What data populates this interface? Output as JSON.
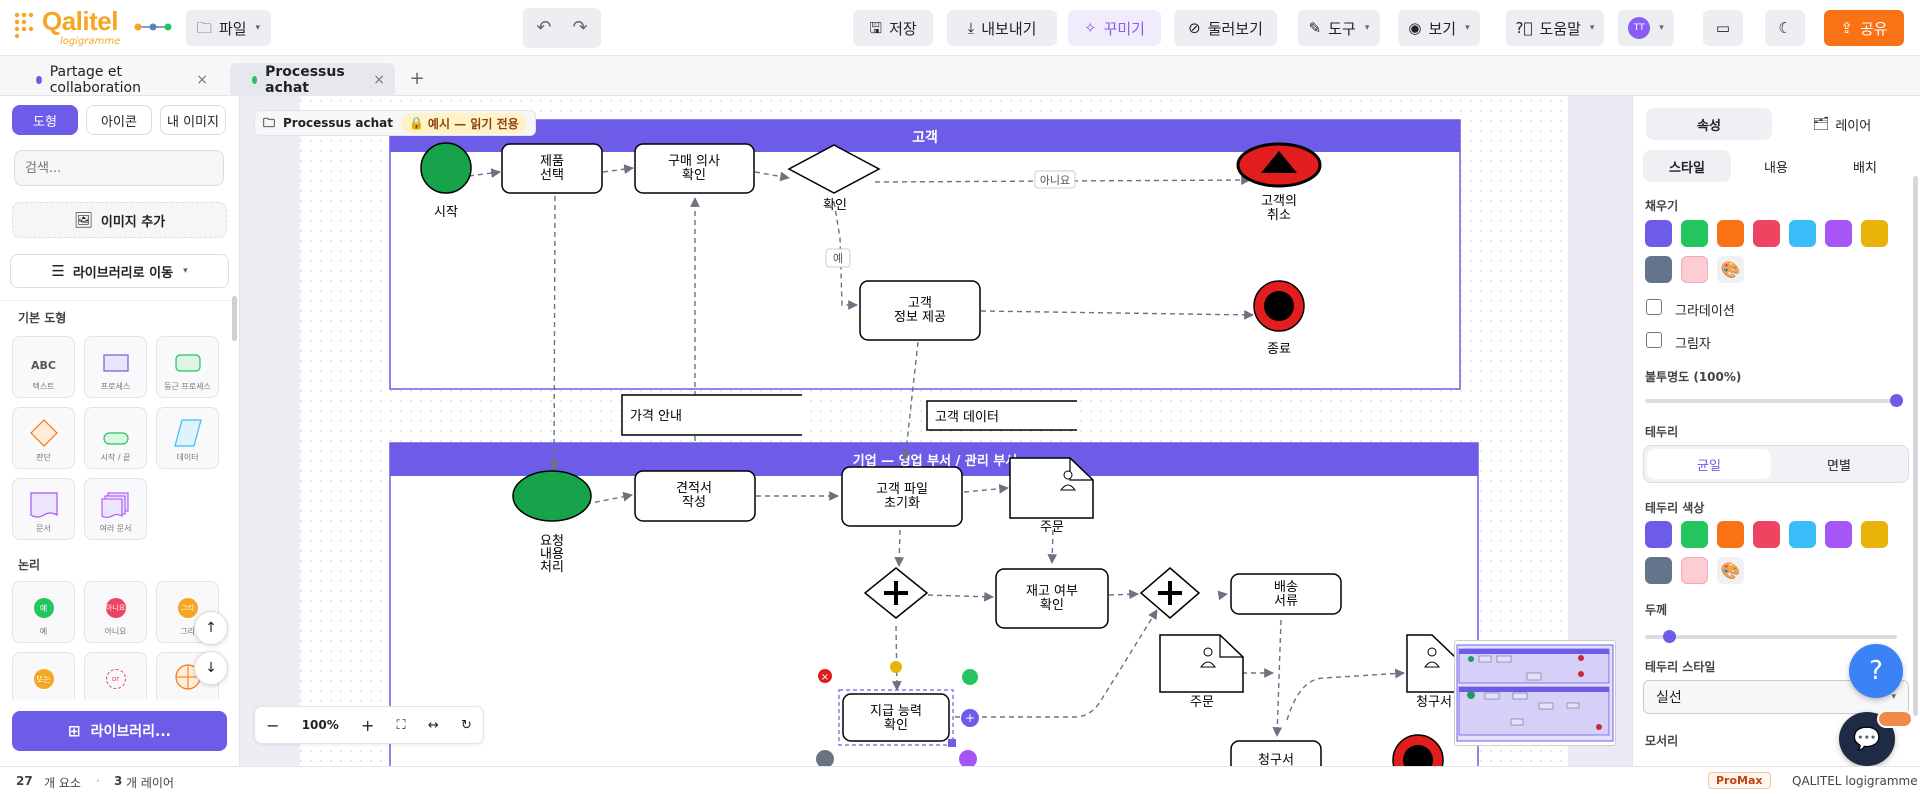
{
  "app": {
    "logo_text": "Qalitel",
    "logo_sub": "logigramme"
  },
  "toolbar": {
    "file": "파일",
    "save": "저장",
    "export": "내보내기",
    "decorate": "꾸미기",
    "tour": "둘러보기",
    "tools": "도구",
    "view": "보기",
    "help": "도움말",
    "avatar": "TT",
    "share": "공유"
  },
  "tabs": [
    {
      "label": "Partage et collaboration",
      "color": "#6c5ce7"
    },
    {
      "label": "Processus achat",
      "color": "#22c55e"
    }
  ],
  "sidebar": {
    "tabs": [
      "도형",
      "아이콘",
      "내 이미지"
    ],
    "search_placeholder": "검색...",
    "add_image": "이미지 추가",
    "goto_library": "라이브러리로 이동",
    "section_basic": "기본 도형",
    "basic_shapes": [
      "텍스트",
      "프로세스",
      "둥근 프로세스",
      "판단",
      "시작 / 끝",
      "데이터",
      "문서",
      "여러 문서"
    ],
    "abc": "ABC",
    "section_logic": "논리",
    "logic_shapes": [
      "예",
      "아니요",
      "그리"
    ],
    "logic_labels": [
      "예",
      "아니요",
      "그리"
    ],
    "logic2_labels": [
      "또는",
      "or"
    ],
    "library_button": "라이브러리..."
  },
  "canvas": {
    "breadcrumb": "Processus achat",
    "readonly_badge": "예시 — 읽기 전용",
    "zoom": "100%",
    "lane1_title": "고객",
    "lane2_title": "기업 — 영업 부서 / 관리 부서",
    "nodes": {
      "start": "시작",
      "choose_l1": "제품",
      "choose_l2": "선택",
      "intent_l1": "구매 의사",
      "intent_l2": "확인",
      "decision": "확인",
      "no": "아니요",
      "yes": "예",
      "cancel_l1": "고객의",
      "cancel_l2": "취소",
      "info_l1": "고객",
      "info_l2": "정보 제공",
      "end": "종료",
      "price": "가격 안내",
      "custdata": "고객 데이터",
      "req_l1": "요청",
      "req_l2": "내용",
      "req_l3": "처리",
      "quote_l1": "견적서",
      "quote_l2": "작성",
      "file_l1": "고객 파일",
      "file_l2": "초기화",
      "order": "주문",
      "stock_l1": "재고 여부",
      "stock_l2": "확인",
      "ship_l1": "배송",
      "ship_l2": "서류",
      "order2": "주문",
      "invoice": "청구서",
      "invoice2": "청구서",
      "pay_l1": "지급 능력",
      "pay_l2": "확인"
    }
  },
  "rpanel": {
    "tabs": [
      "속성",
      "레이어"
    ],
    "subtabs": [
      "스타일",
      "내용",
      "배치"
    ],
    "fill": "채우기",
    "gradient": "그라데이션",
    "shadow": "그림자",
    "opacity": "불투명도 (100%)",
    "border": "테두리",
    "border_modes": [
      "균일",
      "면별"
    ],
    "border_color": "테두리 색상",
    "thickness": "두께",
    "border_style": "테두리 스타일",
    "border_style_value": "실선",
    "corners": "모서리",
    "colors": [
      "#6c5ce7",
      "#22c55e",
      "#f97316",
      "#ef4461",
      "#38bdf8",
      "#a855f7",
      "#eab308",
      "#64748b",
      "#fecdd3"
    ]
  },
  "status": {
    "count_elements": "27",
    "elements_label": "개 요소",
    "count_layers": "3",
    "layers_label": "개 레이어",
    "plan": "ProMax",
    "brand": "QALITEL logigramme"
  }
}
